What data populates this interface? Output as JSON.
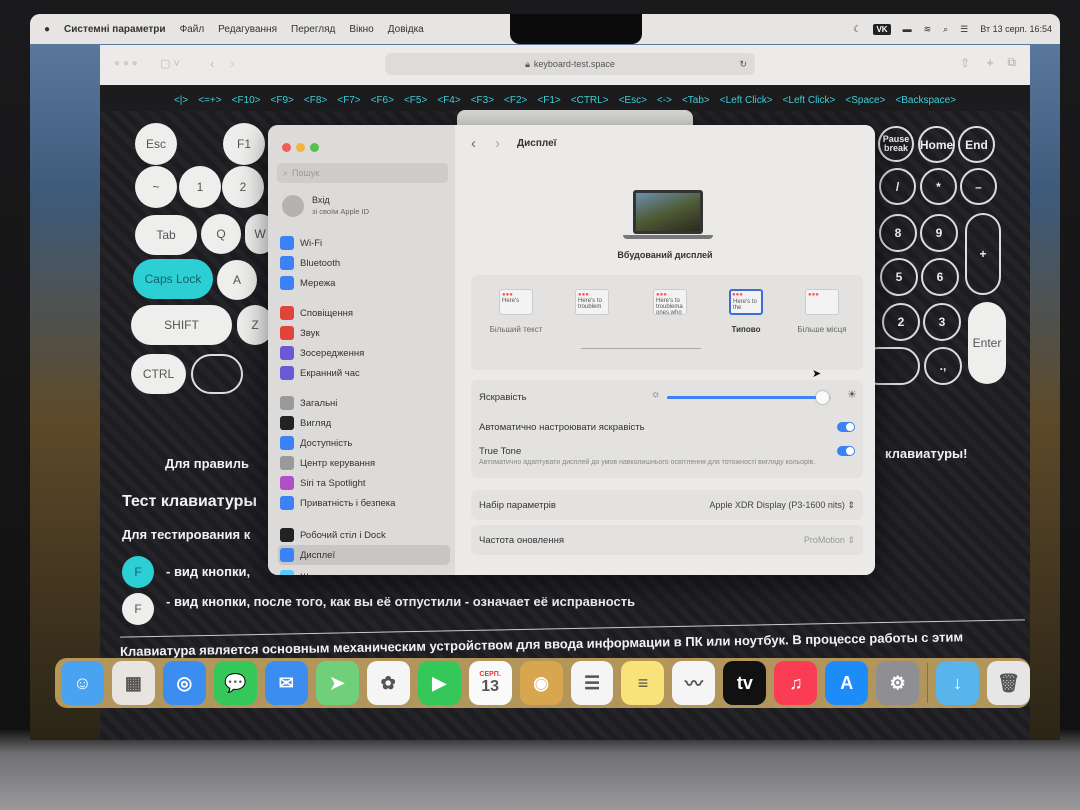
{
  "menubar": {
    "app": "Системні параметри",
    "items": [
      "Файл",
      "Редагування",
      "Перегляд",
      "Вікно",
      "Довідка"
    ],
    "status": {
      "vk": "VK",
      "datetime": "Вт 13 серп. 16:54"
    }
  },
  "browser": {
    "url": "keyboard-test.space"
  },
  "key_strip": [
    "<|>",
    "<=+>",
    "<F10>",
    "<F9>",
    "<F8>",
    "<F7>",
    "<F6>",
    "<F5>",
    "<F4>",
    "<F3>",
    "<F2>",
    "<F1>",
    "<CTRL>",
    "<Esc>",
    "<->",
    "<Tab>",
    "<Left Click>",
    "<Left Click>",
    "<Space>",
    "<Backspace>"
  ],
  "keys_left": {
    "esc": "Esc",
    "f1": "F1",
    "tilde": "~",
    "k1": "1",
    "k2": "2",
    "tab": "Tab",
    "q": "Q",
    "w": "W",
    "caps": "Caps Lock",
    "a": "A",
    "shift": "SHIFT",
    "z": "Z",
    "ctrl": "CTRL"
  },
  "keys_right": {
    "pause": "Pause break",
    "home": "Home",
    "end": "End",
    "slash": "/",
    "star": "*",
    "minus": "–",
    "k8": "8",
    "k9": "9",
    "plus": "+",
    "k5": "5",
    "k6": "6",
    "k2": "2",
    "k3": "3",
    "enter": "Enter",
    "dot": ".,"
  },
  "page": {
    "notice_left": "Для правиль",
    "notice_right": "клавиатуры!",
    "heading": "Тест клавиатуры",
    "intro": "Для тестирования к",
    "legend": [
      {
        "key": "F",
        "text": "- вид кнопки,",
        "color": "#2ccfd4"
      },
      {
        "key": "F",
        "text": "- вид кнопки, после того, как вы её отпустили - означает её исправность",
        "color": "#f2f2f2"
      }
    ],
    "paragraph": "Клавиатура является основным механическим устройством для ввода информации в ПК или ноутбук. В процессе работы с этим"
  },
  "settings": {
    "search_placeholder": "Пошук",
    "account": {
      "title": "Вхід",
      "subtitle": "зі своїм Apple ID"
    },
    "sidebar": [
      {
        "label": "Wi-Fi",
        "icon": "wifi-icon",
        "color": "#3b82f6"
      },
      {
        "label": "Bluetooth",
        "icon": "bluetooth-icon",
        "color": "#3b82f6"
      },
      {
        "label": "Мережа",
        "icon": "globe-icon",
        "color": "#3b82f6"
      },
      {
        "label": "Сповіщення",
        "icon": "bell-icon",
        "color": "#e0443a"
      },
      {
        "label": "Звук",
        "icon": "speaker-icon",
        "color": "#e0443a"
      },
      {
        "label": "Зосередження",
        "icon": "moon-icon",
        "color": "#6a5ad6"
      },
      {
        "label": "Екранний час",
        "icon": "hourglass-icon",
        "color": "#6a5ad6"
      },
      {
        "label": "Загальні",
        "icon": "gear-icon",
        "color": "#9a9a9a"
      },
      {
        "label": "Вигляд",
        "icon": "appearance-icon",
        "color": "#222"
      },
      {
        "label": "Доступність",
        "icon": "accessibility-icon",
        "color": "#3b82f6"
      },
      {
        "label": "Центр керування",
        "icon": "control-center-icon",
        "color": "#9a9a9a"
      },
      {
        "label": "Siri та Spotlight",
        "icon": "siri-icon",
        "color": "#b04fc8"
      },
      {
        "label": "Приватність і безпека",
        "icon": "hand-icon",
        "color": "#3b82f6"
      },
      {
        "label": "Робочий стіл і Dock",
        "icon": "dock-icon",
        "color": "#222"
      },
      {
        "label": "Дисплеї",
        "icon": "sun-icon",
        "color": "#3b82f6",
        "selected": true
      },
      {
        "label": "Шпалери",
        "icon": "wallpaper-icon",
        "color": "#5ac8fa"
      }
    ],
    "title": "Дисплеї",
    "display_name": "Вбудований дисплей",
    "resolutions": [
      {
        "label": "Більший текст",
        "sample": "Here's"
      },
      {
        "label": "",
        "sample": "Here's to troublem"
      },
      {
        "label": "",
        "sample": "Here's to troublema ones.who"
      },
      {
        "label": "Типово",
        "sample": "Here's to the",
        "selected": true
      },
      {
        "label": "Більше місця",
        "sample": ""
      }
    ],
    "brightness": {
      "label": "Яскравість",
      "value": 0.95
    },
    "auto_brightness": {
      "label": "Автоматично настроювати яскравість",
      "on": true
    },
    "true_tone": {
      "label": "True Tone",
      "description": "Автоматично адаптувати дисплей до умов навколишнього освітлення для тотожності вигляду кольорів.",
      "on": true
    },
    "preset": {
      "label": "Набір параметрів",
      "value": "Apple XDR Display (P3-1600 nits)"
    },
    "refresh": {
      "label": "Частота оновлення",
      "value": "ProMotion"
    }
  },
  "dock": [
    {
      "name": "Finder",
      "icon": "finder-icon",
      "color": "#4aa3f0",
      "glyph": "☺"
    },
    {
      "name": "Launchpad",
      "icon": "launchpad-icon",
      "color": "#e8e4e0",
      "glyph": "▦"
    },
    {
      "name": "Safari",
      "icon": "safari-icon",
      "color": "#3b8ef0",
      "glyph": "◎"
    },
    {
      "name": "Messages",
      "icon": "messages-icon",
      "color": "#34c759",
      "glyph": "💬"
    },
    {
      "name": "Mail",
      "icon": "mail-icon",
      "color": "#3b8ef0",
      "glyph": "✉"
    },
    {
      "name": "Maps",
      "icon": "maps-icon",
      "color": "#6fcf7a",
      "glyph": "➤"
    },
    {
      "name": "Photos",
      "icon": "photos-icon",
      "color": "#f5f5f5",
      "glyph": "✿"
    },
    {
      "name": "FaceTime",
      "icon": "facetime-icon",
      "color": "#34c759",
      "glyph": "▶"
    },
    {
      "name": "Calendar",
      "icon": "calendar-icon",
      "color": "#fafafa",
      "glyph": "13",
      "month": "СЕРП."
    },
    {
      "name": "Contacts",
      "icon": "contacts-icon",
      "color": "#d8a64e",
      "glyph": "◉"
    },
    {
      "name": "Reminders",
      "icon": "reminders-icon",
      "color": "#f5f5f5",
      "glyph": "☰"
    },
    {
      "name": "Notes",
      "icon": "notes-icon",
      "color": "#f9e27a",
      "glyph": "≡"
    },
    {
      "name": "Freeform",
      "icon": "freeform-icon",
      "color": "#f5f5f5",
      "glyph": "〰"
    },
    {
      "name": "TV",
      "icon": "tv-icon",
      "color": "#111",
      "glyph": "tv"
    },
    {
      "name": "Music",
      "icon": "music-icon",
      "color": "#fa3c55",
      "glyph": "♫"
    },
    {
      "name": "App Store",
      "icon": "app-store-icon",
      "color": "#1d8cf8",
      "glyph": "A"
    },
    {
      "name": "System Settings",
      "icon": "settings-icon",
      "color": "#8e8e93",
      "glyph": "⚙"
    },
    {
      "name": "Downloads",
      "icon": "downloads-folder-icon",
      "color": "#5ab4ec",
      "glyph": "↓"
    },
    {
      "name": "Trash",
      "icon": "trash-icon",
      "color": "#e6e6e6",
      "glyph": "🗑"
    }
  ]
}
